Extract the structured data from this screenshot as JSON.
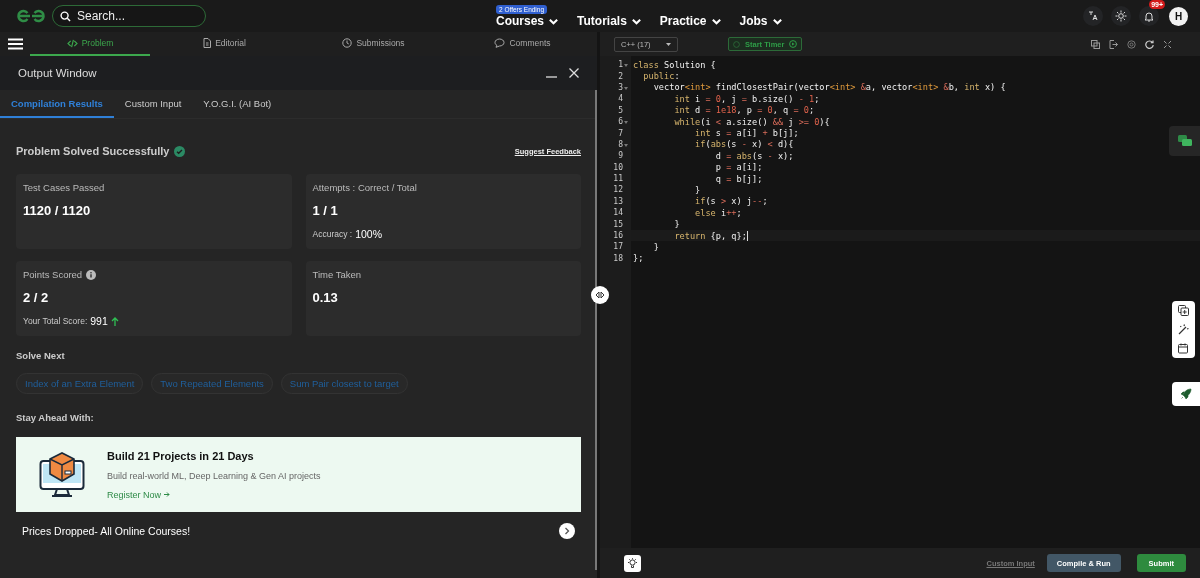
{
  "topbar": {
    "search": {
      "placeholder": "Search..."
    },
    "nav": [
      {
        "label": "Courses",
        "badge": "2 Offers Ending"
      },
      {
        "label": "Tutorials"
      },
      {
        "label": "Practice"
      },
      {
        "label": "Jobs"
      }
    ],
    "notification_count": "99+",
    "avatar": "H"
  },
  "problem_tabs": [
    {
      "label": "Problem",
      "kind": "code",
      "selected": true
    },
    {
      "label": "Editorial",
      "kind": "doc",
      "selected": false
    },
    {
      "label": "Submissions",
      "kind": "clock",
      "selected": false
    },
    {
      "label": "Comments",
      "kind": "chat",
      "selected": false
    }
  ],
  "output_window": {
    "title": "Output Window",
    "tabs": [
      {
        "label": "Compilation Results",
        "selected": true
      },
      {
        "label": "Custom Input",
        "selected": false
      },
      {
        "label": "Y.O.G.I. (AI Bot)",
        "selected": false
      }
    ],
    "status": "Problem Solved Successfully",
    "feedback_link": "Suggest Feedback",
    "cards": [
      {
        "label": "Test Cases Passed",
        "value": "1120 / 1120",
        "info": false
      },
      {
        "label": "Attempts : Correct / Total",
        "value": "1 / 1",
        "info": false,
        "note_label": "Accuracy :",
        "note_value": "100%",
        "trend_up": false
      },
      {
        "label": "Points Scored",
        "value": "2 / 2",
        "info": true,
        "note_label": "Your Total Score:",
        "note_value": "991",
        "trend_up": true
      },
      {
        "label": "Time Taken",
        "value": "0.13",
        "info": false
      }
    ],
    "solve_next_heading": "Solve Next",
    "solve_next": [
      "Index of an Extra Element",
      "Two Repeated Elements",
      "Sum Pair closest to target"
    ],
    "stay_ahead_heading": "Stay Ahead With:",
    "promo": {
      "title": "Build 21 Projects in 21 Days",
      "subtitle": "Build real-world ML, Deep Learning & Gen AI projects",
      "link": "Register Now"
    },
    "offer": "Prices Dropped- All Online Courses!"
  },
  "editor": {
    "language": "C++ (17)",
    "timer_button": "Start Timer",
    "lines": [
      {
        "n": "1",
        "fold": true,
        "active": false,
        "tokens": [
          {
            "kind": "k",
            "text": "class"
          },
          {
            "kind": "p",
            "text": " Solution {"
          }
        ]
      },
      {
        "n": "2",
        "fold": false,
        "active": false,
        "tokens": [
          {
            "kind": "k",
            "text": "  public"
          },
          {
            "kind": "p",
            "text": ":"
          }
        ]
      },
      {
        "n": "3",
        "fold": true,
        "active": false,
        "tokens": [
          {
            "kind": "p",
            "text": "    vector"
          },
          {
            "kind": "t",
            "text": "<int>"
          },
          {
            "kind": "p",
            "text": " findClosestPair(vector"
          },
          {
            "kind": "t",
            "text": "<int>"
          },
          {
            "kind": "o",
            "text": " &"
          },
          {
            "kind": "p",
            "text": "a, vector"
          },
          {
            "kind": "t",
            "text": "<int>"
          },
          {
            "kind": "o",
            "text": " &"
          },
          {
            "kind": "p",
            "text": "b, "
          },
          {
            "kind": "k",
            "text": "int"
          },
          {
            "kind": "p",
            "text": " x) {"
          }
        ]
      },
      {
        "n": "4",
        "fold": false,
        "active": false,
        "tokens": [
          {
            "kind": "k",
            "text": "        int"
          },
          {
            "kind": "p",
            "text": " i "
          },
          {
            "kind": "o",
            "text": "="
          },
          {
            "kind": "n",
            "text": " 0"
          },
          {
            "kind": "p",
            "text": ", j "
          },
          {
            "kind": "o",
            "text": "="
          },
          {
            "kind": "p",
            "text": " b.size() "
          },
          {
            "kind": "o",
            "text": "-"
          },
          {
            "kind": "n",
            "text": " 1"
          },
          {
            "kind": "p",
            "text": ";"
          }
        ]
      },
      {
        "n": "5",
        "fold": false,
        "active": false,
        "tokens": [
          {
            "kind": "k",
            "text": "        int"
          },
          {
            "kind": "p",
            "text": " d "
          },
          {
            "kind": "o",
            "text": "="
          },
          {
            "kind": "n",
            "text": " 1e18"
          },
          {
            "kind": "p",
            "text": ", p "
          },
          {
            "kind": "o",
            "text": "="
          },
          {
            "kind": "n",
            "text": " 0"
          },
          {
            "kind": "p",
            "text": ", q "
          },
          {
            "kind": "o",
            "text": "="
          },
          {
            "kind": "n",
            "text": " 0"
          },
          {
            "kind": "p",
            "text": ";"
          }
        ]
      },
      {
        "n": "6",
        "fold": true,
        "active": false,
        "tokens": [
          {
            "kind": "k",
            "text": "        while"
          },
          {
            "kind": "p",
            "text": "(i "
          },
          {
            "kind": "o",
            "text": "<"
          },
          {
            "kind": "p",
            "text": " a.size() "
          },
          {
            "kind": "o",
            "text": "&&"
          },
          {
            "kind": "p",
            "text": " j "
          },
          {
            "kind": "o",
            "text": ">="
          },
          {
            "kind": "n",
            "text": " 0"
          },
          {
            "kind": "p",
            "text": "){"
          }
        ]
      },
      {
        "n": "7",
        "fold": false,
        "active": false,
        "tokens": [
          {
            "kind": "k",
            "text": "            int"
          },
          {
            "kind": "p",
            "text": " s "
          },
          {
            "kind": "o",
            "text": "="
          },
          {
            "kind": "p",
            "text": " a[i] "
          },
          {
            "kind": "o",
            "text": "+"
          },
          {
            "kind": "p",
            "text": " b[j];"
          }
        ]
      },
      {
        "n": "8",
        "fold": true,
        "active": false,
        "tokens": [
          {
            "kind": "k",
            "text": "            if"
          },
          {
            "kind": "p",
            "text": "("
          },
          {
            "kind": "k",
            "text": "abs"
          },
          {
            "kind": "p",
            "text": "(s "
          },
          {
            "kind": "o",
            "text": "-"
          },
          {
            "kind": "p",
            "text": " x) "
          },
          {
            "kind": "o",
            "text": "<"
          },
          {
            "kind": "p",
            "text": " d){"
          }
        ]
      },
      {
        "n": "9",
        "fold": false,
        "active": false,
        "tokens": [
          {
            "kind": "p",
            "text": "                d "
          },
          {
            "kind": "o",
            "text": "="
          },
          {
            "kind": "k",
            "text": " abs"
          },
          {
            "kind": "p",
            "text": "(s "
          },
          {
            "kind": "o",
            "text": "-"
          },
          {
            "kind": "p",
            "text": " x);"
          }
        ]
      },
      {
        "n": "10",
        "fold": false,
        "active": false,
        "tokens": [
          {
            "kind": "p",
            "text": "                p "
          },
          {
            "kind": "o",
            "text": "="
          },
          {
            "kind": "p",
            "text": " a[i];"
          }
        ]
      },
      {
        "n": "11",
        "fold": false,
        "active": false,
        "tokens": [
          {
            "kind": "p",
            "text": "                q "
          },
          {
            "kind": "o",
            "text": "="
          },
          {
            "kind": "p",
            "text": " b[j];"
          }
        ]
      },
      {
        "n": "12",
        "fold": false,
        "active": false,
        "tokens": [
          {
            "kind": "p",
            "text": "            }"
          }
        ]
      },
      {
        "n": "13",
        "fold": false,
        "active": false,
        "tokens": [
          {
            "kind": "k",
            "text": "            if"
          },
          {
            "kind": "p",
            "text": "(s "
          },
          {
            "kind": "o",
            "text": ">"
          },
          {
            "kind": "p",
            "text": " x) j"
          },
          {
            "kind": "o",
            "text": "--"
          },
          {
            "kind": "p",
            "text": ";"
          }
        ]
      },
      {
        "n": "14",
        "fold": false,
        "active": false,
        "tokens": [
          {
            "kind": "k",
            "text": "            else"
          },
          {
            "kind": "p",
            "text": " i"
          },
          {
            "kind": "o",
            "text": "++"
          },
          {
            "kind": "p",
            "text": ";"
          }
        ]
      },
      {
        "n": "15",
        "fold": false,
        "active": false,
        "tokens": [
          {
            "kind": "p",
            "text": "        }"
          }
        ]
      },
      {
        "n": "16",
        "fold": false,
        "active": true,
        "tokens": [
          {
            "kind": "k",
            "text": "        return"
          },
          {
            "kind": "p",
            "text": " {p, q};"
          }
        ]
      },
      {
        "n": "17",
        "fold": false,
        "active": false,
        "tokens": [
          {
            "kind": "p",
            "text": "    }"
          }
        ]
      },
      {
        "n": "18",
        "fold": false,
        "active": false,
        "tokens": [
          {
            "kind": "p",
            "text": "};"
          }
        ]
      }
    ],
    "custom_input_link": "Custom Input",
    "compile_button": "Compile & Run",
    "submit_button": "Submit"
  }
}
